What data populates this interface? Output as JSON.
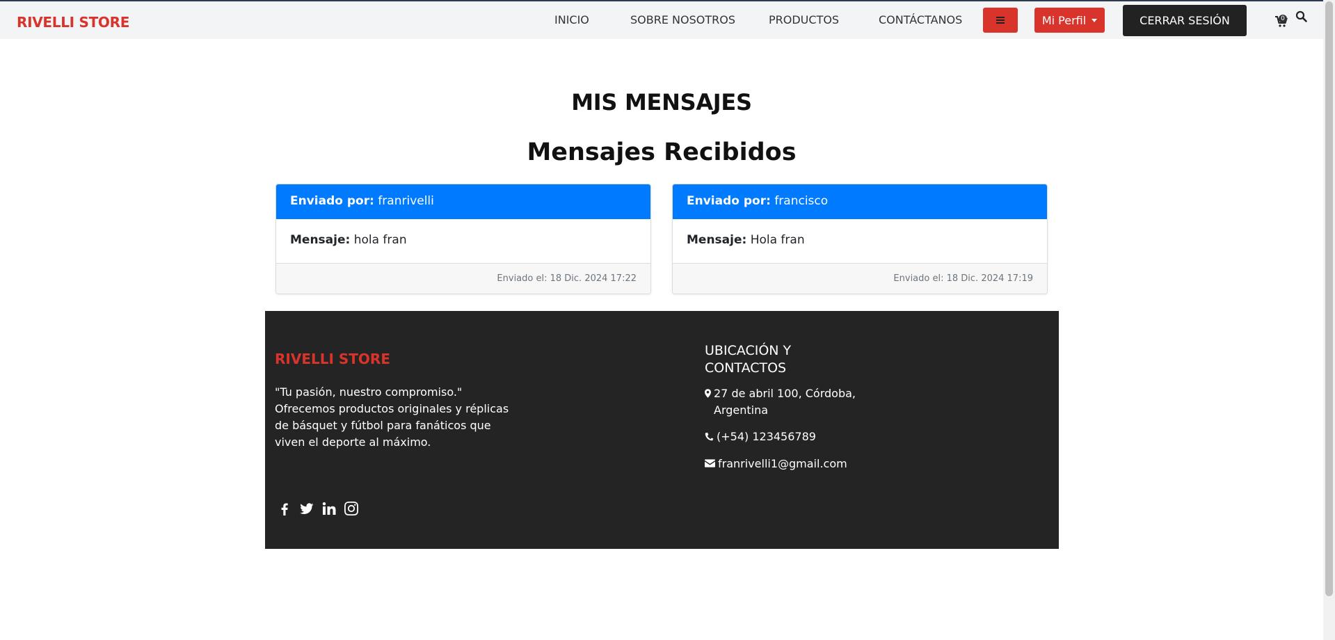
{
  "navbar": {
    "brand": "RIVELLI STORE",
    "links": [
      "INICIO",
      "SOBRE NOSOTROS",
      "PRODUCTOS",
      "CONTÁCTANOS"
    ],
    "profile_label": "Mi Perfil",
    "logout_label": "CERRAR SESIÓN",
    "cart_count": "0"
  },
  "main": {
    "title": "MIS MENSAJES",
    "subtitle": "Mensajes Recibidos",
    "sender_label": "Enviado por:",
    "message_label": "Mensaje:",
    "messages": [
      {
        "sender": "franrivelli",
        "text": "hola fran",
        "sent": "Enviado el: 18 Dic. 2024 17:22"
      },
      {
        "sender": "francisco",
        "text": "Hola fran",
        "sent": "Enviado el: 18 Dic. 2024 17:19"
      }
    ]
  },
  "footer": {
    "brand": "RIVELLI STORE",
    "description": "\"Tu pasión, nuestro compromiso.\" Ofrecemos productos originales y réplicas de básquet y fútbol para fanáticos que viven el deporte al máximo.",
    "location_heading": "UBICACIÓN Y CONTACTOS",
    "address": "27 de abril 100, Córdoba, Argentina",
    "phone": "(+54) 123456789",
    "email": "franrivelli1@gmail.com",
    "social_icons": [
      "facebook-icon",
      "twitter-icon",
      "linkedin-icon",
      "instagram-icon"
    ]
  },
  "colors": {
    "brand_red": "#d9342b",
    "card_header_blue": "#007bff",
    "footer_bg": "#242424",
    "navbar_bg": "#f3f4f5"
  }
}
